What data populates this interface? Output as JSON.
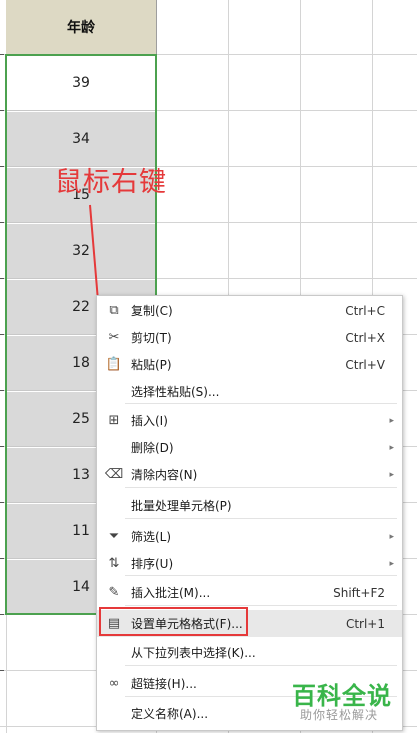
{
  "sheet": {
    "column_header": "年龄",
    "cells": [
      "39",
      "34",
      "15",
      "32",
      "22",
      "18",
      "25",
      "13",
      "11",
      "14"
    ]
  },
  "annotation": {
    "text": "鼠标右键",
    "color": "#e5393a"
  },
  "context_menu": {
    "items": [
      {
        "icon": "copy-icon",
        "label": "复制(C)",
        "shortcut": "Ctrl+C"
      },
      {
        "icon": "scissors-icon",
        "label": "剪切(T)",
        "shortcut": "Ctrl+X"
      },
      {
        "icon": "paste-icon",
        "label": "粘贴(P)",
        "shortcut": "Ctrl+V"
      },
      {
        "icon": "",
        "label": "选择性粘贴(S)...",
        "shortcut": ""
      },
      {
        "icon": "insert-icon",
        "label": "插入(I)",
        "shortcut": "",
        "submenu": true
      },
      {
        "icon": "",
        "label": "删除(D)",
        "shortcut": "",
        "submenu": true
      },
      {
        "icon": "eraser-icon",
        "label": "清除内容(N)",
        "shortcut": "",
        "submenu": true
      },
      {
        "icon": "",
        "label": "批量处理单元格(P)",
        "shortcut": ""
      },
      {
        "icon": "filter-icon",
        "label": "筛选(L)",
        "shortcut": "",
        "submenu": true
      },
      {
        "icon": "sort-az-icon",
        "label": "排序(U)",
        "shortcut": "",
        "submenu": true
      },
      {
        "icon": "comment-icon",
        "label": "插入批注(M)...",
        "shortcut": "Shift+F2"
      },
      {
        "icon": "format-cells-icon",
        "label": "设置单元格格式(F)...",
        "shortcut": "Ctrl+1",
        "highlighted": true
      },
      {
        "icon": "",
        "label": "从下拉列表中选择(K)...",
        "shortcut": ""
      },
      {
        "icon": "link-icon",
        "label": "超链接(H)...",
        "shortcut": ""
      },
      {
        "icon": "",
        "label": "定义名称(A)...",
        "shortcut": ""
      }
    ]
  },
  "watermark": {
    "main": "百科全说",
    "sub": "助你轻松解决",
    "color": "#39b54a"
  },
  "colors": {
    "selection_border": "#4ca14f",
    "header_bg": "#ddd9c4",
    "highlight": "#e5393a"
  }
}
